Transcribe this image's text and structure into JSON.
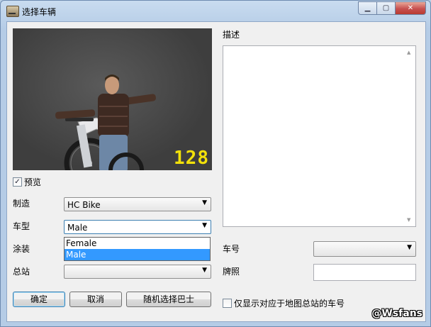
{
  "window": {
    "title": "选择车辆",
    "minimize_icon": "minimize-icon",
    "maximize_icon": "maximize-icon",
    "close_icon": "close-icon"
  },
  "preview": {
    "counter": "128",
    "checkbox_label": "预览",
    "checked": true
  },
  "form": {
    "maker_label": "制造",
    "maker_value": "HC Bike",
    "model_label": "车型",
    "model_value": "Male",
    "model_options": [
      "Female",
      "Male"
    ],
    "paint_label": "涂装",
    "station_label": "总站",
    "station_value": ""
  },
  "description": {
    "label": "描述",
    "text": ""
  },
  "right_form": {
    "fleet_label": "车号",
    "fleet_value": "",
    "plate_label": "牌照",
    "plate_value": ""
  },
  "buttons": {
    "ok": "确定",
    "cancel": "取消",
    "random_bus": "随机选择巴士"
  },
  "filter_checkbox": {
    "label": "仅显示对应于地图总站的车号",
    "checked": false
  },
  "watermark": "@Wsfans"
}
